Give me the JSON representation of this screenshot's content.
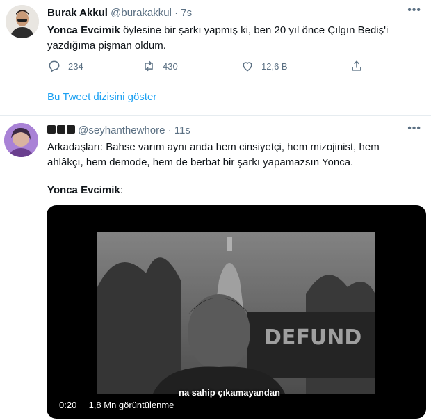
{
  "tweet1": {
    "author_name": "Burak Akkul",
    "handle": "@burakakkul",
    "separator": "·",
    "time": "7s",
    "text_bold": "Yonca Evcimik",
    "text_line1": " öylesine bir şarkı yapmış ki, ben 20 yıl önce Çılgın Bediş'i",
    "text_line2": "yazdığıma pişman oldum.",
    "replies": "234",
    "retweets": "430",
    "likes": "12,6 B",
    "show_thread": "Bu Tweet dizisini göster"
  },
  "tweet2": {
    "author_name": "",
    "handle": "@seyhanthewhore",
    "separator": "·",
    "time": "11s",
    "text_line1": "Arkadaşları: Bahse varım aynı anda hem cinsiyetçi, hem mizojinist, hem",
    "text_line2": "ahlâkçı, hem demode, hem de berbat bir şarkı yapamazsın Yonca.",
    "quote_bold": "Yonca Evcimik",
    "quote_colon": ":",
    "video": {
      "time": "0:20",
      "views": "1,8 Mn görüntülenme",
      "subtitle": "na sahip çıkamayandan",
      "sign_text": "DEFUND"
    }
  },
  "colors": {
    "accent": "#1da1f2",
    "muted": "#5b7083",
    "text": "#0f1419"
  },
  "icons": [
    "reply-icon",
    "retweet-icon",
    "like-icon",
    "share-icon",
    "more-icon"
  ]
}
